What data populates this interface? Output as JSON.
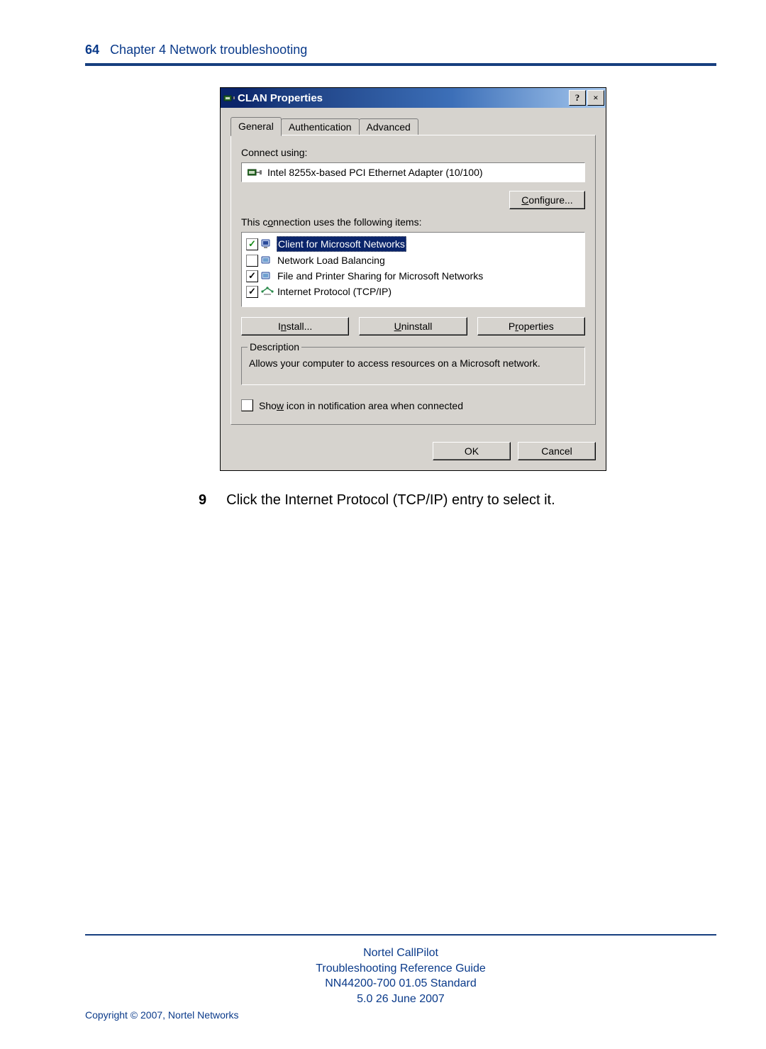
{
  "header": {
    "page_number": "64",
    "chapter": "Chapter 4  Network troubleshooting"
  },
  "dialog": {
    "title": "CLAN Properties",
    "help_symbol": "?",
    "close_symbol": "×",
    "tabs": {
      "general": "General",
      "authentication": "Authentication",
      "advanced": "Advanced"
    },
    "connect_using_label": "Connect using:",
    "adapter_name": "Intel 8255x-based PCI Ethernet Adapter (10/100)",
    "configure_btn_prefix": "C",
    "configure_btn_rest": "onfigure...",
    "items_label_prefix": "This c",
    "items_label_o": "o",
    "items_label_rest": "nnection uses the following items:",
    "items": [
      {
        "label": "Client for Microsoft Networks",
        "checked": true,
        "selected": true
      },
      {
        "label": "Network Load Balancing",
        "checked": false,
        "selected": false
      },
      {
        "label": "File and Printer Sharing for Microsoft Networks",
        "checked": true,
        "selected": false
      },
      {
        "label": "Internet Protocol (TCP/IP)",
        "checked": true,
        "selected": false
      }
    ],
    "install_pre": "I",
    "install_n": "n",
    "install_post": "stall...",
    "uninstall_pre": "",
    "uninstall_u": "U",
    "uninstall_post": "ninstall",
    "properties_pre": "P",
    "properties_r": "r",
    "properties_post": "operties",
    "description_title": "Description",
    "description_text": "Allows your computer to access resources on a Microsoft network.",
    "show_pre": "Sho",
    "show_w": "w",
    "show_post": " icon in notification area when connected",
    "ok_label": "OK",
    "cancel_label": "Cancel"
  },
  "instruction": {
    "number": "9",
    "text": "Click the Internet Protocol (TCP/IP) entry to select it."
  },
  "footer": {
    "line1": "Nortel CallPilot",
    "line2": "Troubleshooting Reference Guide",
    "line3": "NN44200-700   01.05   Standard",
    "line4": "5.0   26 June 2007",
    "copyright": "Copyright © 2007, Nortel Networks"
  }
}
